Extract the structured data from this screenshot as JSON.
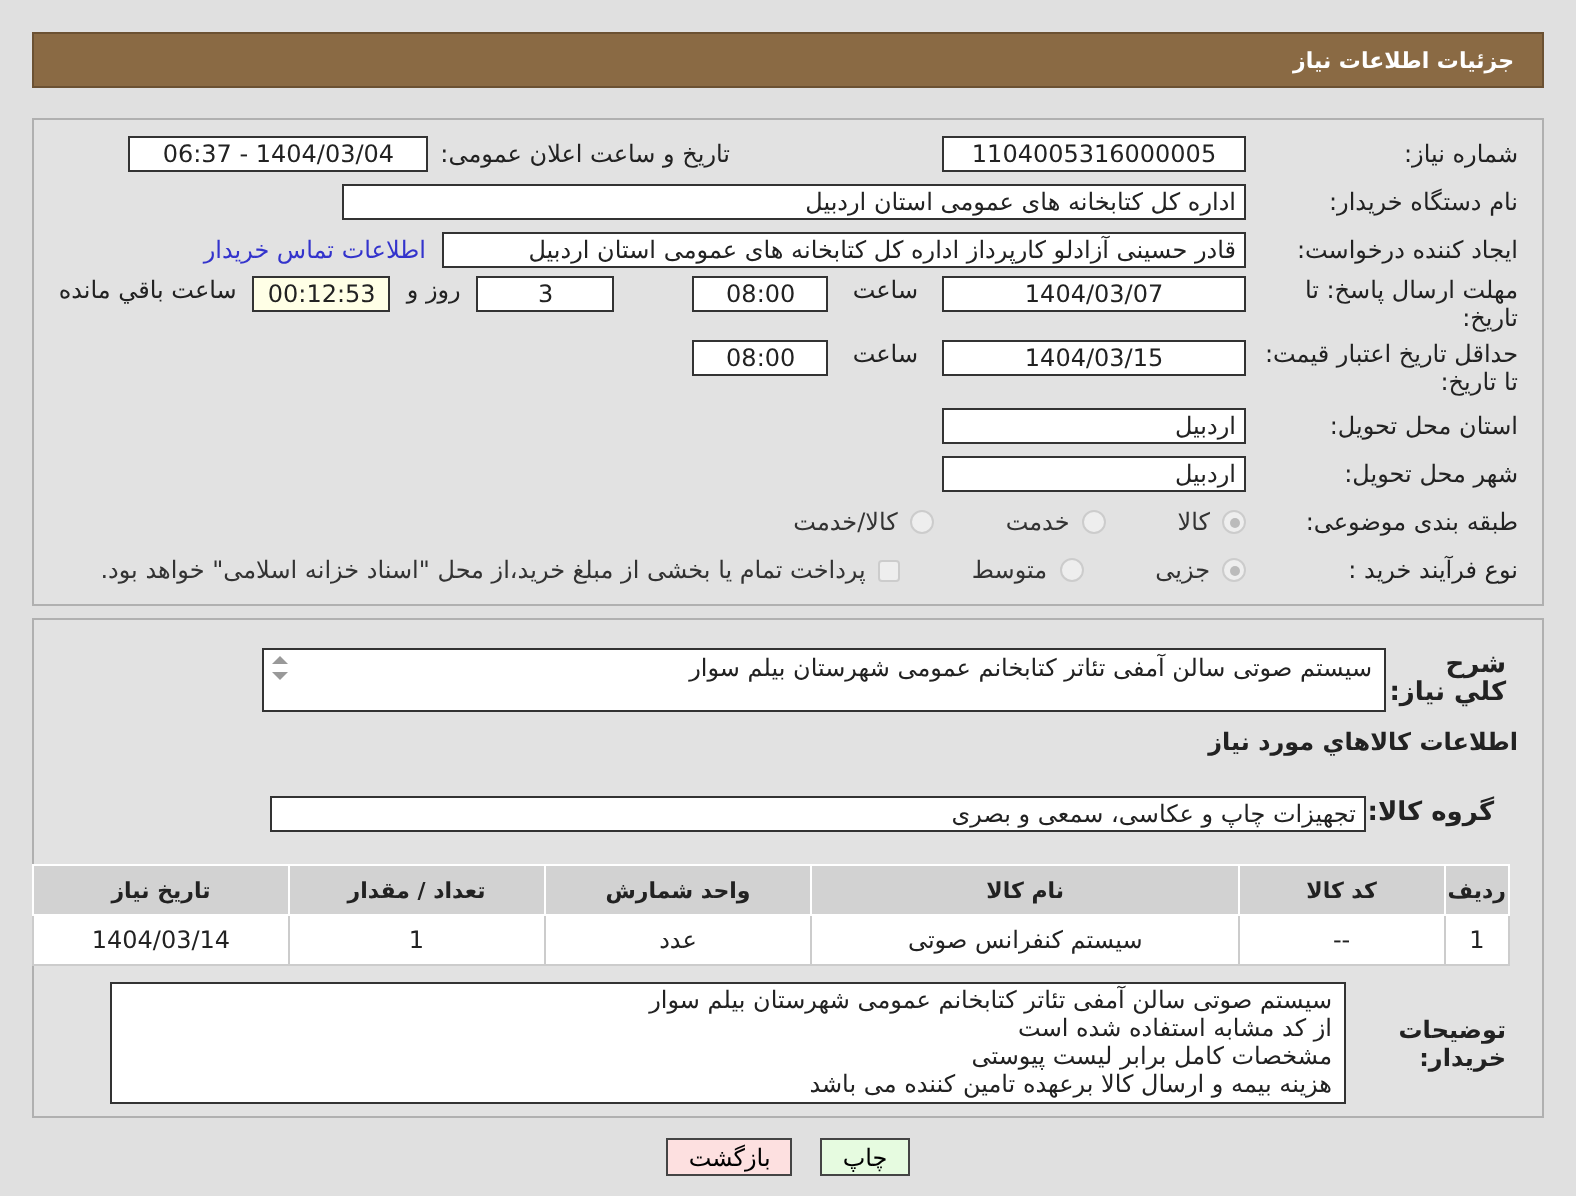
{
  "header": {
    "title": "جزئیات اطلاعات نیاز"
  },
  "need_number": {
    "label": "شماره نیاز:",
    "value": "1104005316000005"
  },
  "announce": {
    "label": "تاریخ و ساعت اعلان عمومی:",
    "value": "1404/03/04 - 06:37"
  },
  "buyer_org": {
    "label": "نام دستگاه خریدار:",
    "value": "اداره کل کتابخانه های عمومی استان اردبیل"
  },
  "requester": {
    "label": "ایجاد کننده درخواست:",
    "value": "قادر حسینی آزادلو کارپرداز اداره کل کتابخانه های عمومی استان اردبیل",
    "link": "اطلاعات تماس خریدار"
  },
  "reply_deadline": {
    "label": "مهلت ارسال پاسخ: تا تاریخ:",
    "date": "1404/03/07",
    "time_label": "ساعت",
    "time": "08:00",
    "days": "3",
    "days_label": "روز و",
    "remaining": "00:12:53",
    "remaining_label": "ساعت باقي مانده"
  },
  "price_validity": {
    "label": "حداقل تاریخ اعتبار قیمت: تا تاریخ:",
    "date": "1404/03/15",
    "time_label": "ساعت",
    "time": "08:00"
  },
  "province": {
    "label": "استان محل تحویل:",
    "value": "اردبیل"
  },
  "city": {
    "label": "شهر محل تحویل:",
    "value": "اردبیل"
  },
  "category": {
    "label": "طبقه بندی موضوعی:",
    "options": [
      {
        "label": "کالا",
        "selected": true
      },
      {
        "label": "خدمت",
        "selected": false
      },
      {
        "label": "کالا/خدمت",
        "selected": false
      }
    ]
  },
  "process": {
    "label": "نوع فرآیند خرید :",
    "options": [
      {
        "label": "جزیی",
        "selected": true
      },
      {
        "label": "متوسط",
        "selected": false
      }
    ],
    "treasury": {
      "label": "پرداخت تمام یا بخشی از مبلغ خرید،از محل \"اسناد خزانه اسلامی\" خواهد بود.",
      "checked": false
    }
  },
  "description": {
    "label": "شرح کلي نیاز:",
    "value": "سیستم صوتی سالن آمفی تئاتر کتابخانم عمومی شهرستان بیلم سوار"
  },
  "goods_heading": "اطلاعات کالاهاي مورد نياز",
  "goods_group": {
    "label": "گروه کالا:",
    "value": "تجهیزات چاپ و عکاسی، سمعی و بصری"
  },
  "table": {
    "columns": [
      "ردیف",
      "کد کالا",
      "نام کالا",
      "واحد شمارش",
      "تعداد / مقدار",
      "تاریخ نیاز"
    ],
    "rows": [
      [
        "1",
        "--",
        "سیستم کنفرانس صوتی",
        "عدد",
        "1",
        "1404/03/14"
      ]
    ]
  },
  "buyer_notes": {
    "label": "توضیحات خریدار:",
    "lines": [
      "سیستم صوتی سالن آمفی تئاتر کتابخانم عمومی شهرستان بیلم سوار",
      "از کد مشابه استفاده شده است",
      "مشخصات کامل برابر لیست پیوستی",
      "هزینه بیمه و ارسال کالا برعهده تامین کننده می باشد"
    ]
  },
  "buttons": [
    {
      "label": "چاپ",
      "kind": "print"
    },
    {
      "label": "بازگشت",
      "kind": "back"
    }
  ]
}
